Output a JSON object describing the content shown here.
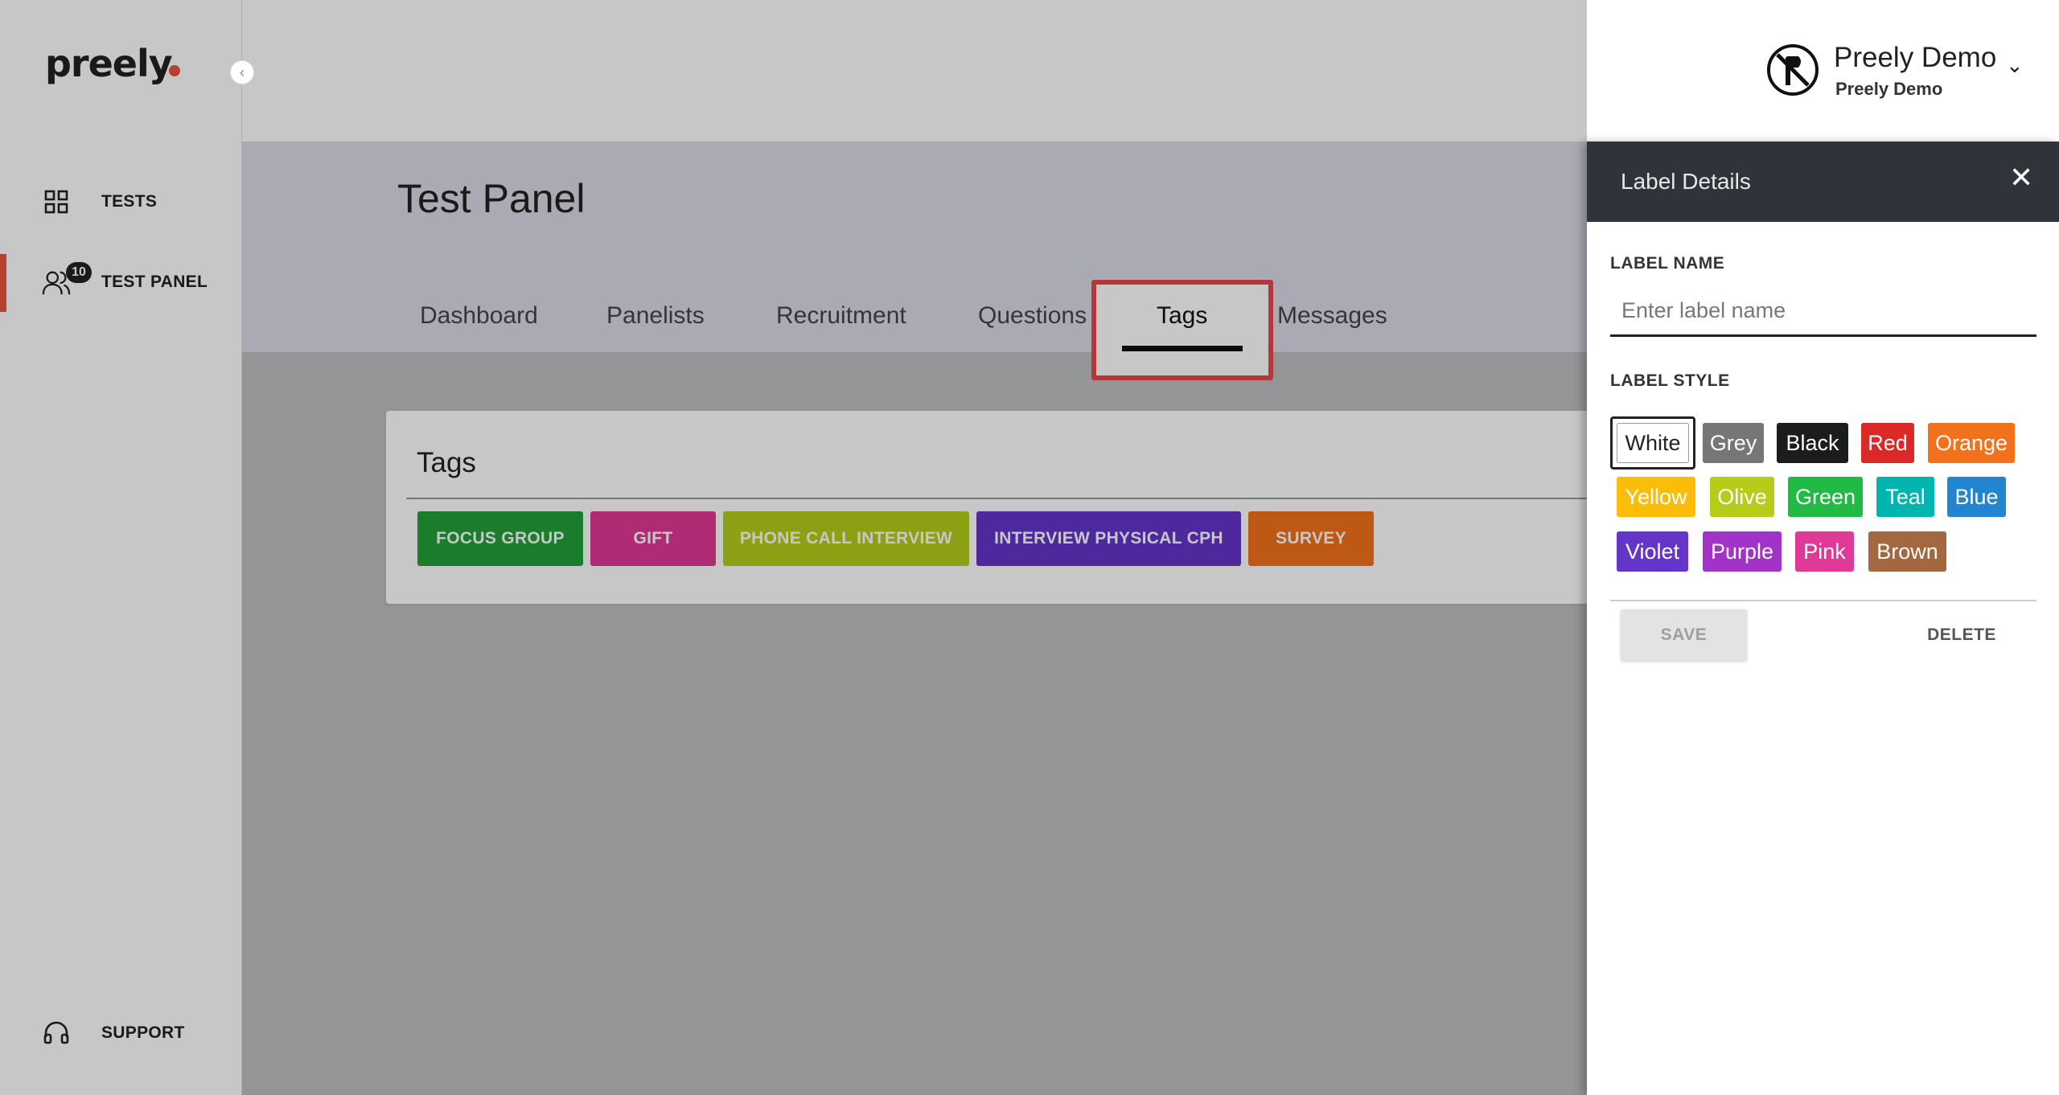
{
  "sidebar": {
    "logo": "preely",
    "items": [
      {
        "label": "TESTS",
        "icon": "grid-icon"
      },
      {
        "label": "TEST PANEL",
        "icon": "users-icon",
        "badge": "10"
      },
      {
        "label": "SUPPORT",
        "icon": "headset-icon"
      }
    ]
  },
  "header": {
    "user_name": "Preely Demo",
    "user_org": "Preely Demo"
  },
  "main": {
    "title": "Test Panel",
    "tabs": [
      "Dashboard",
      "Panelists",
      "Recruitment",
      "Questions",
      "Tags",
      "Messages"
    ],
    "active_tab": "Tags",
    "card_title": "Tags",
    "tags": [
      {
        "label": "FOCUS GROUP",
        "color": "#21a038"
      },
      {
        "label": "GIFT",
        "color": "#e03996"
      },
      {
        "label": "PHONE CALL INTERVIEW",
        "color": "#b5cc18"
      },
      {
        "label": "INTERVIEW PHYSICAL CPH",
        "color": "#6435c9"
      },
      {
        "label": "SURVEY",
        "color": "#f2711c"
      }
    ]
  },
  "drawer": {
    "title": "Label Details",
    "label_name_heading": "LABEL NAME",
    "label_name_placeholder": "Enter label name",
    "label_name_value": "",
    "label_style_heading": "LABEL STYLE",
    "styles": [
      {
        "label": "White",
        "color": "#ffffff",
        "text": "#222222",
        "selected": true
      },
      {
        "label": "Grey",
        "color": "#767676",
        "text": "#ffffff"
      },
      {
        "label": "Black",
        "color": "#1b1c1d",
        "text": "#ffffff"
      },
      {
        "label": "Red",
        "color": "#db2828",
        "text": "#ffffff"
      },
      {
        "label": "Orange",
        "color": "#f2711c",
        "text": "#ffffff"
      },
      {
        "label": "Yellow",
        "color": "#fbbd08",
        "text": "#ffffff"
      },
      {
        "label": "Olive",
        "color": "#b5cc18",
        "text": "#ffffff"
      },
      {
        "label": "Green",
        "color": "#21ba45",
        "text": "#ffffff"
      },
      {
        "label": "Teal",
        "color": "#00b5ad",
        "text": "#ffffff"
      },
      {
        "label": "Blue",
        "color": "#2185d0",
        "text": "#ffffff"
      },
      {
        "label": "Violet",
        "color": "#6435c9",
        "text": "#ffffff"
      },
      {
        "label": "Purple",
        "color": "#a333c8",
        "text": "#ffffff"
      },
      {
        "label": "Pink",
        "color": "#e03997",
        "text": "#ffffff"
      },
      {
        "label": "Brown",
        "color": "#a5673f",
        "text": "#ffffff"
      }
    ],
    "save_label": "SAVE",
    "delete_label": "DELETE"
  }
}
